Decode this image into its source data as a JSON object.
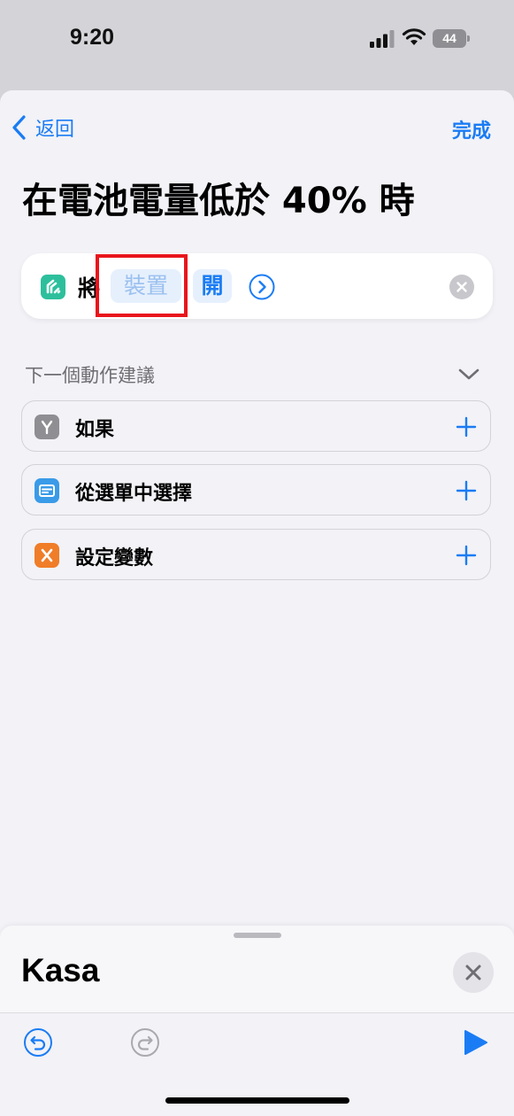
{
  "status_bar": {
    "time": "9:20",
    "battery_level": "44"
  },
  "nav": {
    "back_label": "返回",
    "done_label": "完成"
  },
  "page": {
    "title": "在電池電量低於 40% 時"
  },
  "action": {
    "app_icon": "kasa-app-icon",
    "verb": "將",
    "device_placeholder": "裝置",
    "state_value": "開"
  },
  "suggestions": {
    "header": "下一個動作建議",
    "items": [
      {
        "label": "如果",
        "icon": "branch-icon",
        "color": "#8e8e93"
      },
      {
        "label": "從選單中選擇",
        "icon": "menu-list-icon",
        "color": "#3a9be8"
      },
      {
        "label": "設定變數",
        "icon": "variable-x-icon",
        "color": "#f07d28"
      }
    ]
  },
  "panel": {
    "title": "Kasa"
  },
  "colors": {
    "accent": "#1a7cf4",
    "highlight": "#e8151c",
    "kasa": "#2dbf9c"
  }
}
